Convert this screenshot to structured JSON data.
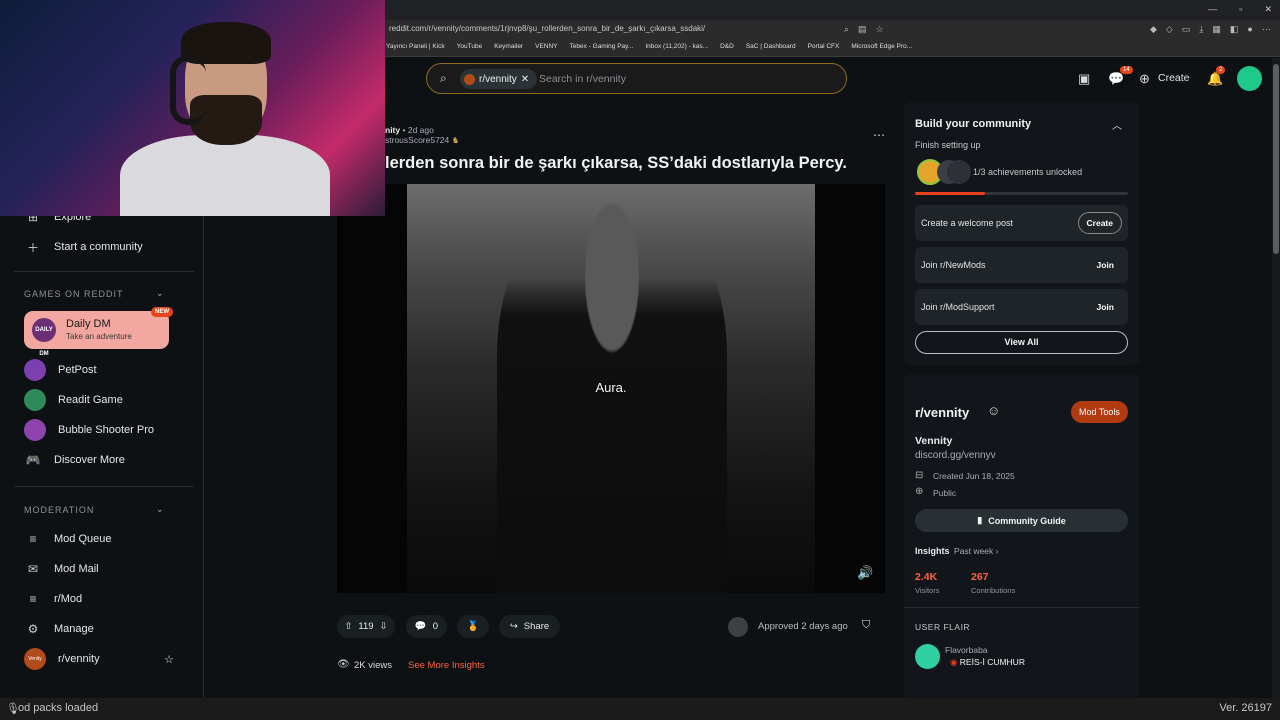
{
  "browser": {
    "url": "reddit.com/r/vennity/comments/1rjnvp8/şu_rollerden_sonra_bir_de_şarkı_çıkarsa_ssdaki/",
    "bookmarks": [
      "Yayıncı Paneli | Kick",
      "YouTube",
      "Keymailer",
      "VENNY",
      "Tebex - Gaming Pay...",
      "Inbox (11,202) - kas...",
      "D&D",
      "SaC | Dashboard",
      "Portal CFX",
      "Microsoft Edge Pro..."
    ]
  },
  "header": {
    "search_chip": "r/vennity",
    "search_placeholder": "Search in r/vennity",
    "chat_badge": "14",
    "create_label": "Create",
    "notif_badge": "2"
  },
  "sidebar": {
    "top_items": [
      {
        "label": "Explore",
        "icon": "explore-icon"
      },
      {
        "label": "Start a community",
        "icon": "plus-icon"
      }
    ],
    "games_heading": "GAMES ON REDDIT",
    "daily_dm": {
      "logo": "DAILY DM",
      "title": "Daily DM",
      "subtitle": "Take an adventure",
      "badge": "NEW"
    },
    "games": [
      {
        "label": "PetPost",
        "color": "#7b3fb0"
      },
      {
        "label": "Readit Game",
        "color": "#2e8b57"
      },
      {
        "label": "Bubble Shooter Pro",
        "color": "#8e44ad"
      }
    ],
    "discover_more": "Discover More",
    "moderation_heading": "MODERATION",
    "mod_items": [
      {
        "label": "Mod Queue",
        "icon": "queue-icon"
      },
      {
        "label": "Mod Mail",
        "icon": "mail-icon"
      },
      {
        "label": "r/Mod",
        "icon": "mod-icon"
      },
      {
        "label": "Manage",
        "icon": "gear-icon"
      }
    ],
    "community": {
      "label": "r/vennity",
      "icon_text": "Venity"
    }
  },
  "post": {
    "subreddit_fragment": "nity",
    "age": "2d ago",
    "author_fragment": "strousScore5724",
    "title": "lerden sonra bir de şarkı çıkarsa, SS’daki dostlarıyla Percy.",
    "video_caption": "Aura.",
    "votes": "119",
    "comments": "0",
    "share_label": "Share",
    "approved": "Approved 2 days ago",
    "views": "2K views",
    "insights_link": "See More Insights"
  },
  "build_community": {
    "title": "Build your community",
    "subtitle": "Finish setting up",
    "achievements": "1/3 achievements unlocked",
    "progress": 0.33,
    "tasks": [
      {
        "label": "Create a welcome post",
        "action": "Create"
      },
      {
        "label": "Join r/NewMods",
        "action": "Join"
      },
      {
        "label": "Join r/ModSupport",
        "action": "Join"
      }
    ],
    "view_all": "View All"
  },
  "community_card": {
    "name": "r/vennity",
    "mod_tools": "Mod Tools",
    "display_name": "Vennity",
    "link": "discord.gg/vennyv",
    "created": "Created Jun 18, 2025",
    "visibility": "Public",
    "guide_button": "Community Guide",
    "insights_label": "Insights",
    "insights_period": "Past week",
    "visitors_value": "2.4K",
    "visitors_label": "Visitors",
    "contrib_value": "267",
    "contrib_label": "Contributions",
    "flair_heading": "USER FLAIR",
    "flair_name": "Flavorbaba",
    "flair_tag": "REİS-İ CUMHUR"
  },
  "statusbar": {
    "left": "od packs loaded",
    "right": "Ver. 26197"
  },
  "colors": {
    "accent": "#ff4500",
    "brand_mod": "#b23a10",
    "bg": "#0e1113"
  }
}
